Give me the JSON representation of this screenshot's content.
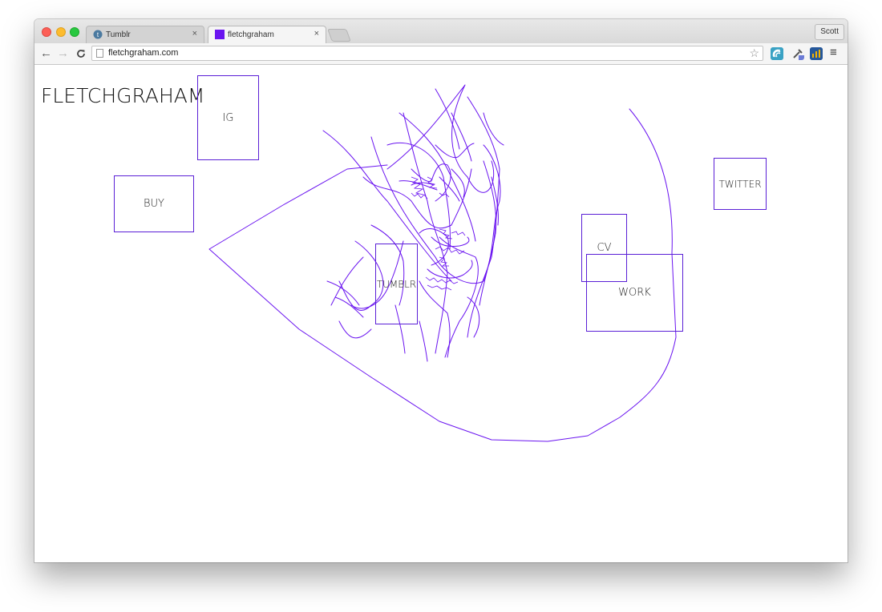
{
  "browser": {
    "tabs": [
      {
        "title": "Tumblr",
        "close": "×",
        "active": false
      },
      {
        "title": "fletchgraham",
        "close": "×",
        "active": true
      }
    ],
    "profile": "Scott",
    "url": "fletchgraham.com",
    "star_icon": "☆",
    "nav": {
      "back": "←",
      "forward": "→",
      "reload": "C"
    },
    "menu_icon": "≡"
  },
  "site": {
    "title": "FLETCHGRAHAM",
    "accent": "#5a1fd6",
    "links": {
      "ig": "IG",
      "buy": "BUY",
      "tumblr": "TUMBLR",
      "cv": "CV",
      "work": "WORK",
      "twitter": "TWITTER"
    }
  }
}
